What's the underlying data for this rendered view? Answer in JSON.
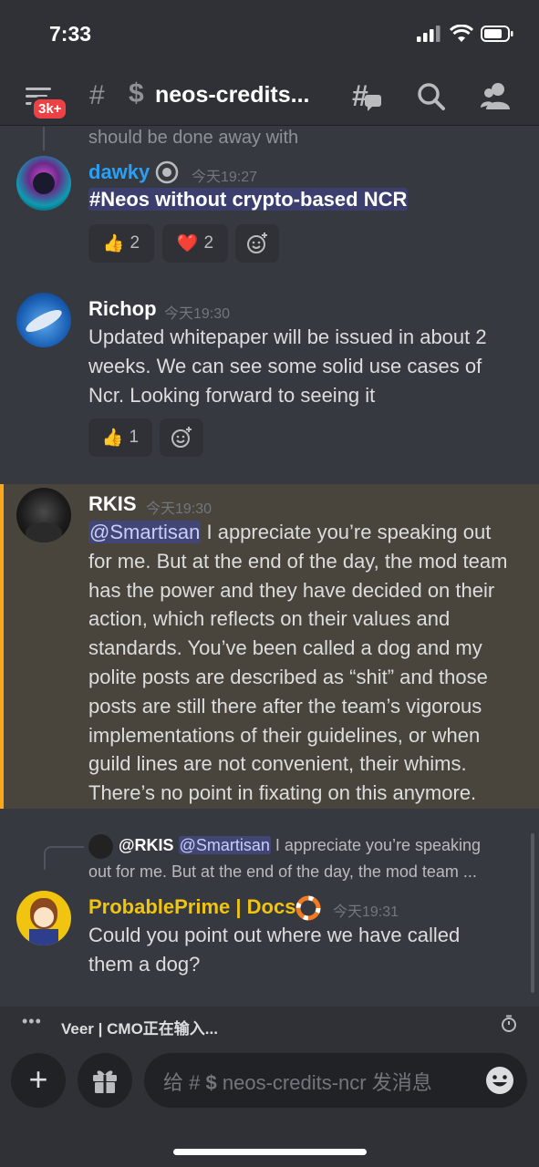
{
  "status_bar": {
    "time": "7:33"
  },
  "header": {
    "badge": "3k+",
    "hash": "#",
    "dollar": "$",
    "channel_name": "neos-credits..."
  },
  "messages": [
    {
      "truncated_text": "should be done away with"
    },
    {
      "author": "dawky",
      "timestamp": "今天19:27",
      "text": "#Neos without crypto-based NCR",
      "reactions": [
        {
          "emoji": "👍",
          "count": "2"
        },
        {
          "emoji": "❤️",
          "count": "2"
        }
      ]
    },
    {
      "author": "Richop",
      "timestamp": "今天19:30",
      "lines": [
        "Updated whitepaper will be issued in about 2",
        "weeks. We can see some solid use cases of",
        "Ncr. Looking forward to seeing it"
      ],
      "reactions": [
        {
          "emoji": "👍",
          "count": "1"
        }
      ]
    },
    {
      "author": "RKIS",
      "timestamp": "今天19:30",
      "mention": "@Smartisan",
      "first_line_rest": " I appreciate you’re speaking out",
      "lines": [
        "for me. But at the end of the day, the mod team",
        "has the power and they have decided on their",
        "action, which reflects on their values and",
        "standards. You’ve been called a dog and my",
        "polite posts are described as “shit” and those",
        "posts are still there after the team’s vigorous",
        "implementations of their guidelines, or when",
        "guild lines are not convenient, their whims.",
        "There’s no point in fixating on this anymore."
      ]
    },
    {
      "reply": {
        "author": "@RKIS",
        "mention": "@Smartisan",
        "text1": " I appreciate you’re speaking",
        "text2": "out for me. But at the end of the day, the mod team ..."
      },
      "author": "ProbablePrime | Docs",
      "timestamp": "今天19:31",
      "lines": [
        "Could you point out where we have called",
        "them a dog?"
      ]
    }
  ],
  "typing": {
    "dots": "•••",
    "text": "Veer | CMO正在输入..."
  },
  "composer": {
    "placeholder_prefix": "给 #",
    "dollar": "$",
    "placeholder_channel": "neos-credits-ncr 发消息",
    "plus": "+"
  },
  "colors": {
    "background": "#36393f",
    "bars": "#2f3136",
    "dawky_name": "#2a9ff4",
    "prime_name": "#f1c40f",
    "mention": "#414675",
    "highlight": "#49443c",
    "highlight_border": "#faa81a"
  }
}
